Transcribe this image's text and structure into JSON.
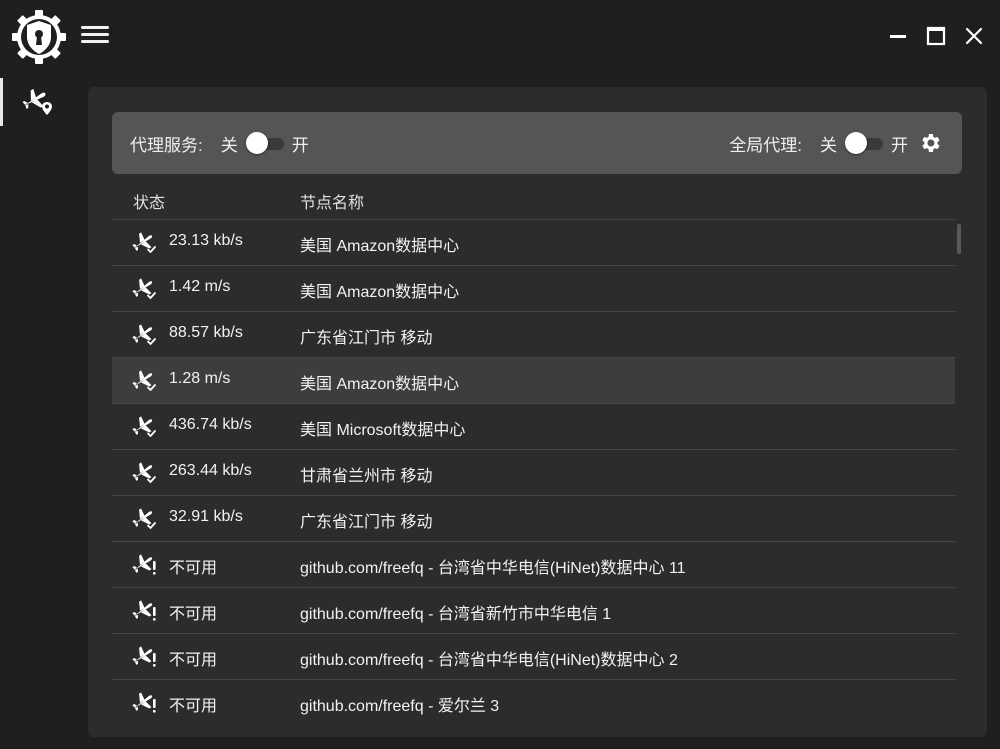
{
  "window": {
    "controls": {
      "minimize_icon": "minimize-icon",
      "maximize_icon": "maximize-icon",
      "close_icon": "close-icon"
    }
  },
  "sidebar": {
    "items": [
      {
        "icon": "plane-location-icon",
        "active": true
      }
    ]
  },
  "control_bar": {
    "proxy_service_label": "代理服务:",
    "proxy_off_label": "关",
    "proxy_on_label": "开",
    "global_proxy_label": "全局代理:",
    "global_off_label": "关",
    "global_on_label": "开"
  },
  "table": {
    "columns": [
      "状态",
      "节点名称"
    ],
    "rows": [
      {
        "status": "23.13 kb/s",
        "name": "美国 Amazon数据中心",
        "ok": true
      },
      {
        "status": "1.42 m/s",
        "name": "美国 Amazon数据中心",
        "ok": true
      },
      {
        "status": "88.57 kb/s",
        "name": "广东省江门市 移动",
        "ok": true
      },
      {
        "status": "1.28 m/s",
        "name": "美国 Amazon数据中心",
        "ok": true,
        "highlight": true
      },
      {
        "status": "436.74 kb/s",
        "name": "美国 Microsoft数据中心",
        "ok": true
      },
      {
        "status": "263.44 kb/s",
        "name": "甘肃省兰州市 移动",
        "ok": true
      },
      {
        "status": "32.91 kb/s",
        "name": "广东省江门市 移动",
        "ok": true
      },
      {
        "status": "不可用",
        "name": "github.com/freefq - 台湾省中华电信(HiNet)数据中心 11",
        "ok": false
      },
      {
        "status": "不可用",
        "name": "github.com/freefq - 台湾省新竹市中华电信 1",
        "ok": false
      },
      {
        "status": "不可用",
        "name": "github.com/freefq - 台湾省中华电信(HiNet)数据中心 2",
        "ok": false
      },
      {
        "status": "不可用",
        "name": "github.com/freefq - 爱尔兰  3",
        "ok": false
      }
    ]
  },
  "colors": {
    "background": "#1f1f1f",
    "panel": "#2c2c2c",
    "control_bar": "#555555",
    "highlight_row": "#3d3d3d",
    "text": "#f2f2f2"
  }
}
